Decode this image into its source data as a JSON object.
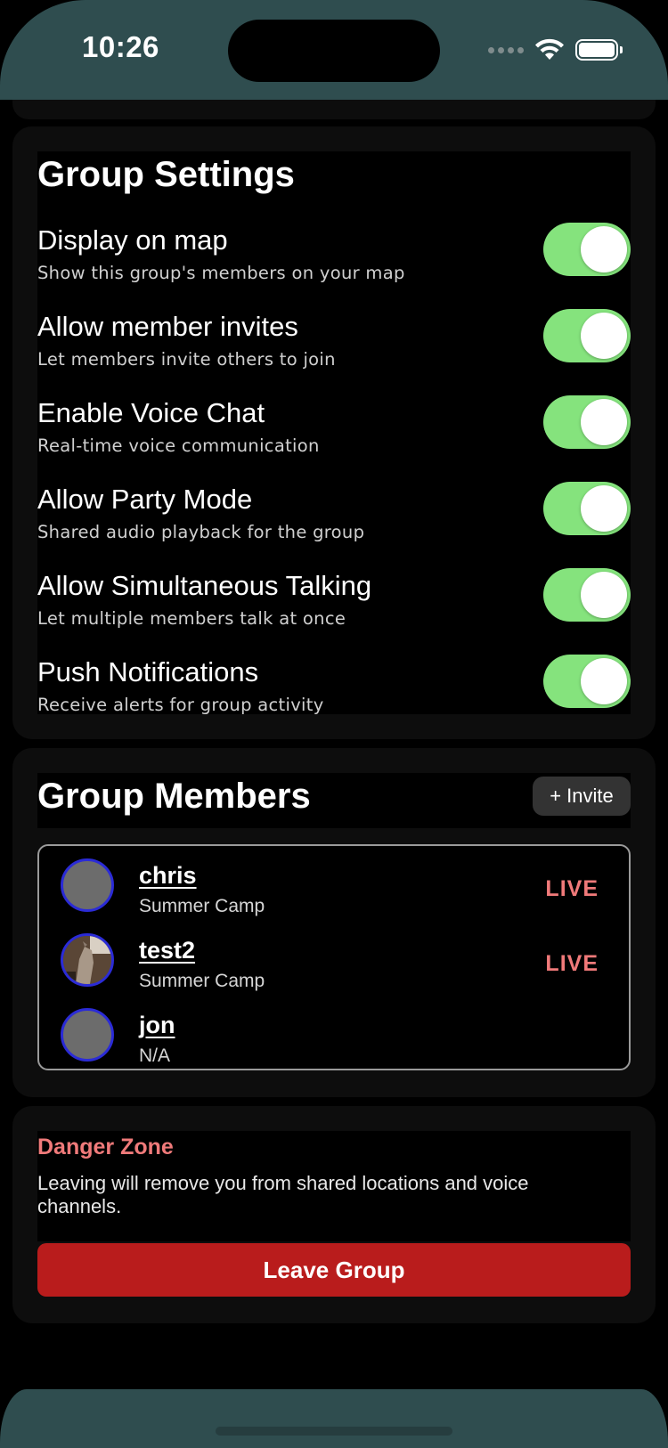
{
  "status_bar": {
    "time": "10:26",
    "signal_icon": "cellular-dots-icon",
    "wifi_icon": "wifi-icon",
    "battery_icon": "battery-full-icon"
  },
  "group_settings": {
    "title": "Group Settings",
    "items": [
      {
        "title": "Display on map",
        "subtitle": "Show this group's members on your map",
        "enabled": true
      },
      {
        "title": "Allow member invites",
        "subtitle": "Let members invite others to join",
        "enabled": true
      },
      {
        "title": "Enable Voice Chat",
        "subtitle": "Real-time voice communication",
        "enabled": true
      },
      {
        "title": "Allow Party Mode",
        "subtitle": "Shared audio playback for the group",
        "enabled": true
      },
      {
        "title": "Allow Simultaneous Talking",
        "subtitle": "Let multiple members talk at once",
        "enabled": true
      },
      {
        "title": "Push Notifications",
        "subtitle": "Receive alerts for group activity",
        "enabled": true
      }
    ]
  },
  "group_members": {
    "title": "Group Members",
    "invite_label": "+ Invite",
    "members": [
      {
        "name": "chris",
        "subtitle": "Summer Camp",
        "status": "LIVE",
        "avatar": "placeholder"
      },
      {
        "name": "test2",
        "subtitle": "Summer Camp",
        "status": "LIVE",
        "avatar": "photo"
      },
      {
        "name": "jon",
        "subtitle": "N/A",
        "status": "",
        "avatar": "placeholder"
      }
    ]
  },
  "danger_zone": {
    "title": "Danger Zone",
    "description": "Leaving will remove you from shared locations and voice channels.",
    "leave_label": "Leave Group"
  },
  "colors": {
    "toggle_on": "#85e37d",
    "danger": "#f07a7a",
    "leave_button": "#b91c1c",
    "chrome": "#2f4d4f",
    "avatar_ring": "#2b2bd6"
  }
}
